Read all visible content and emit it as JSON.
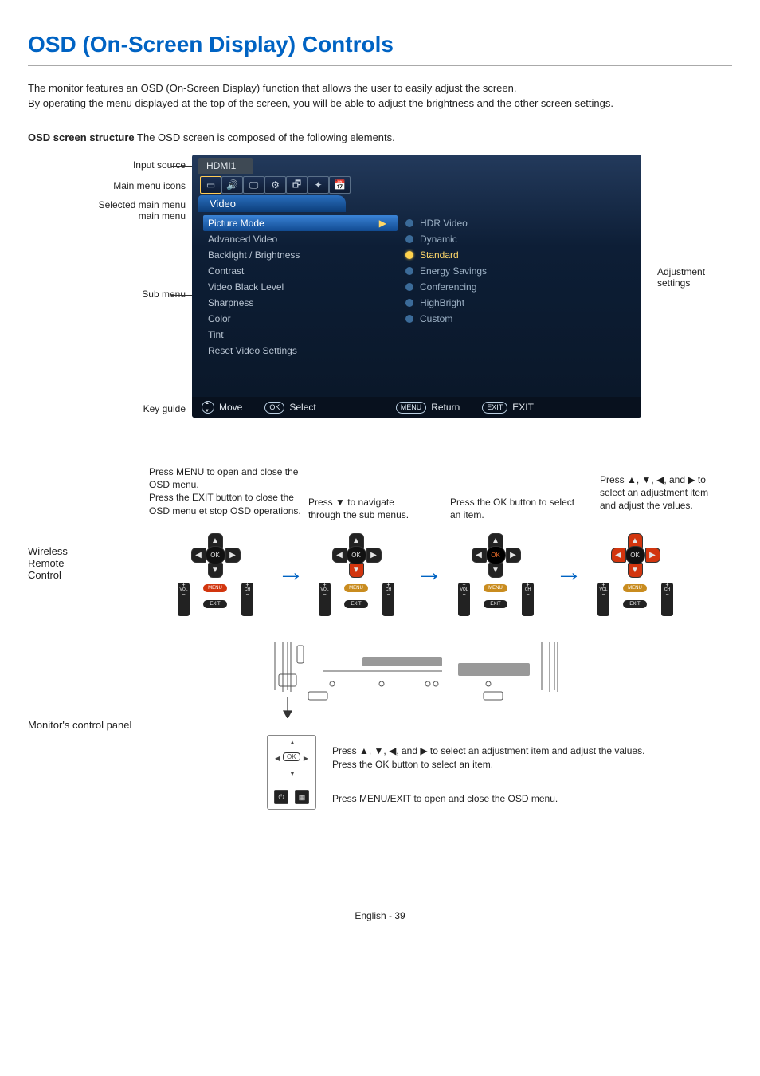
{
  "title": "OSD (On-Screen Display) Controls",
  "intro": [
    "The monitor features an OSD (On-Screen Display) function that allows the user to easily adjust the screen.",
    "By operating the menu displayed at the top of the screen, you will be able to adjust the brightness and the other screen settings."
  ],
  "structure_heading": {
    "bold": "OSD screen structure",
    "rest": " The OSD screen is composed of the following elements."
  },
  "callouts": {
    "input_source": "Input source",
    "main_menu_icons": "Main menu icons",
    "selected_main_menu": "Selected main menu",
    "sub_menu": "Sub menu",
    "key_guide": "Key guide",
    "adjustment_settings": "Adjustment settings"
  },
  "osd": {
    "input": "HDMI1",
    "icons": [
      "▭",
      "🔊",
      "🖵",
      "⚙",
      "🗗",
      "✦",
      "📅"
    ],
    "tab": "Video",
    "left": [
      {
        "label": "Picture Mode",
        "selected": true
      },
      {
        "label": "Advanced Video"
      },
      {
        "label": "Backlight / Brightness"
      },
      {
        "label": "Contrast"
      },
      {
        "label": "Video Black Level"
      },
      {
        "label": "Sharpness"
      },
      {
        "label": "Color"
      },
      {
        "label": "Tint"
      },
      {
        "label": "Reset Video Settings"
      }
    ],
    "right": [
      {
        "label": "HDR Video"
      },
      {
        "label": "Dynamic"
      },
      {
        "label": "Standard",
        "selected": true
      },
      {
        "label": "Energy Savings"
      },
      {
        "label": "Conferencing"
      },
      {
        "label": "HighBright"
      },
      {
        "label": "Custom"
      }
    ],
    "keyguide": {
      "move": "Move",
      "select_icon": "OK",
      "select": "Select",
      "return_icon": "MENU",
      "return": "Return",
      "exit_icon": "EXIT",
      "exit": "EXIT"
    }
  },
  "remote_steps": [
    "Press MENU to open and close the OSD menu.\nPress the EXIT button to close the OSD menu et stop OSD operations.",
    "Press ▼ to navigate through the sub menus.",
    "Press the OK button to select an item.",
    "Press ▲, ▼, ◀, and ▶ to select an adjustment item and adjust the values."
  ],
  "remote_highlights": [
    "menu",
    "down",
    "ok",
    "all"
  ],
  "wrc_label": "Wireless Remote Control",
  "remote_btn": {
    "ok": "OK",
    "menu": "MENU",
    "exit": "EXIT",
    "vol": "VOL",
    "ch": "CH"
  },
  "monitor_panel": {
    "label": "Monitor's control panel",
    "desc1": "Press ▲, ▼, ◀, and ▶ to select an adjustment item and adjust the values.\nPress the OK button to select an item.",
    "desc2": "Press MENU/EXIT to open and close the OSD menu.",
    "ok": "OK"
  },
  "footer": "English - 39"
}
